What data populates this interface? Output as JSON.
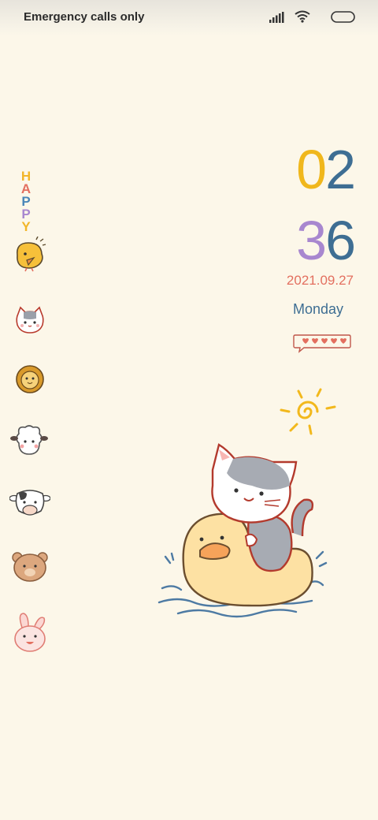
{
  "status_bar": {
    "carrier": "Emergency calls only",
    "icons": [
      "signal-icon",
      "wifi-icon",
      "battery-icon"
    ]
  },
  "sidebar": {
    "happy_letters": [
      "H",
      "A",
      "P",
      "P",
      "Y"
    ],
    "happy_colors": [
      "#f2b62a",
      "#e36f5f",
      "#4a86b8",
      "#a887cf",
      "#f2b62a"
    ],
    "stickers": [
      "chick",
      "cat",
      "lion",
      "sheep",
      "cow",
      "bear",
      "bunny"
    ]
  },
  "clock": {
    "hour_d1": "0",
    "hour_d2": "2",
    "min_d1": "3",
    "min_d2": "6",
    "date": "2021.09.27",
    "weekday": "Monday"
  },
  "colors": {
    "background": "#fcf7e9",
    "yellow": "#f0b71c",
    "blue": "#3e6e93",
    "purple": "#a887cf",
    "coral": "#e36f5f"
  }
}
